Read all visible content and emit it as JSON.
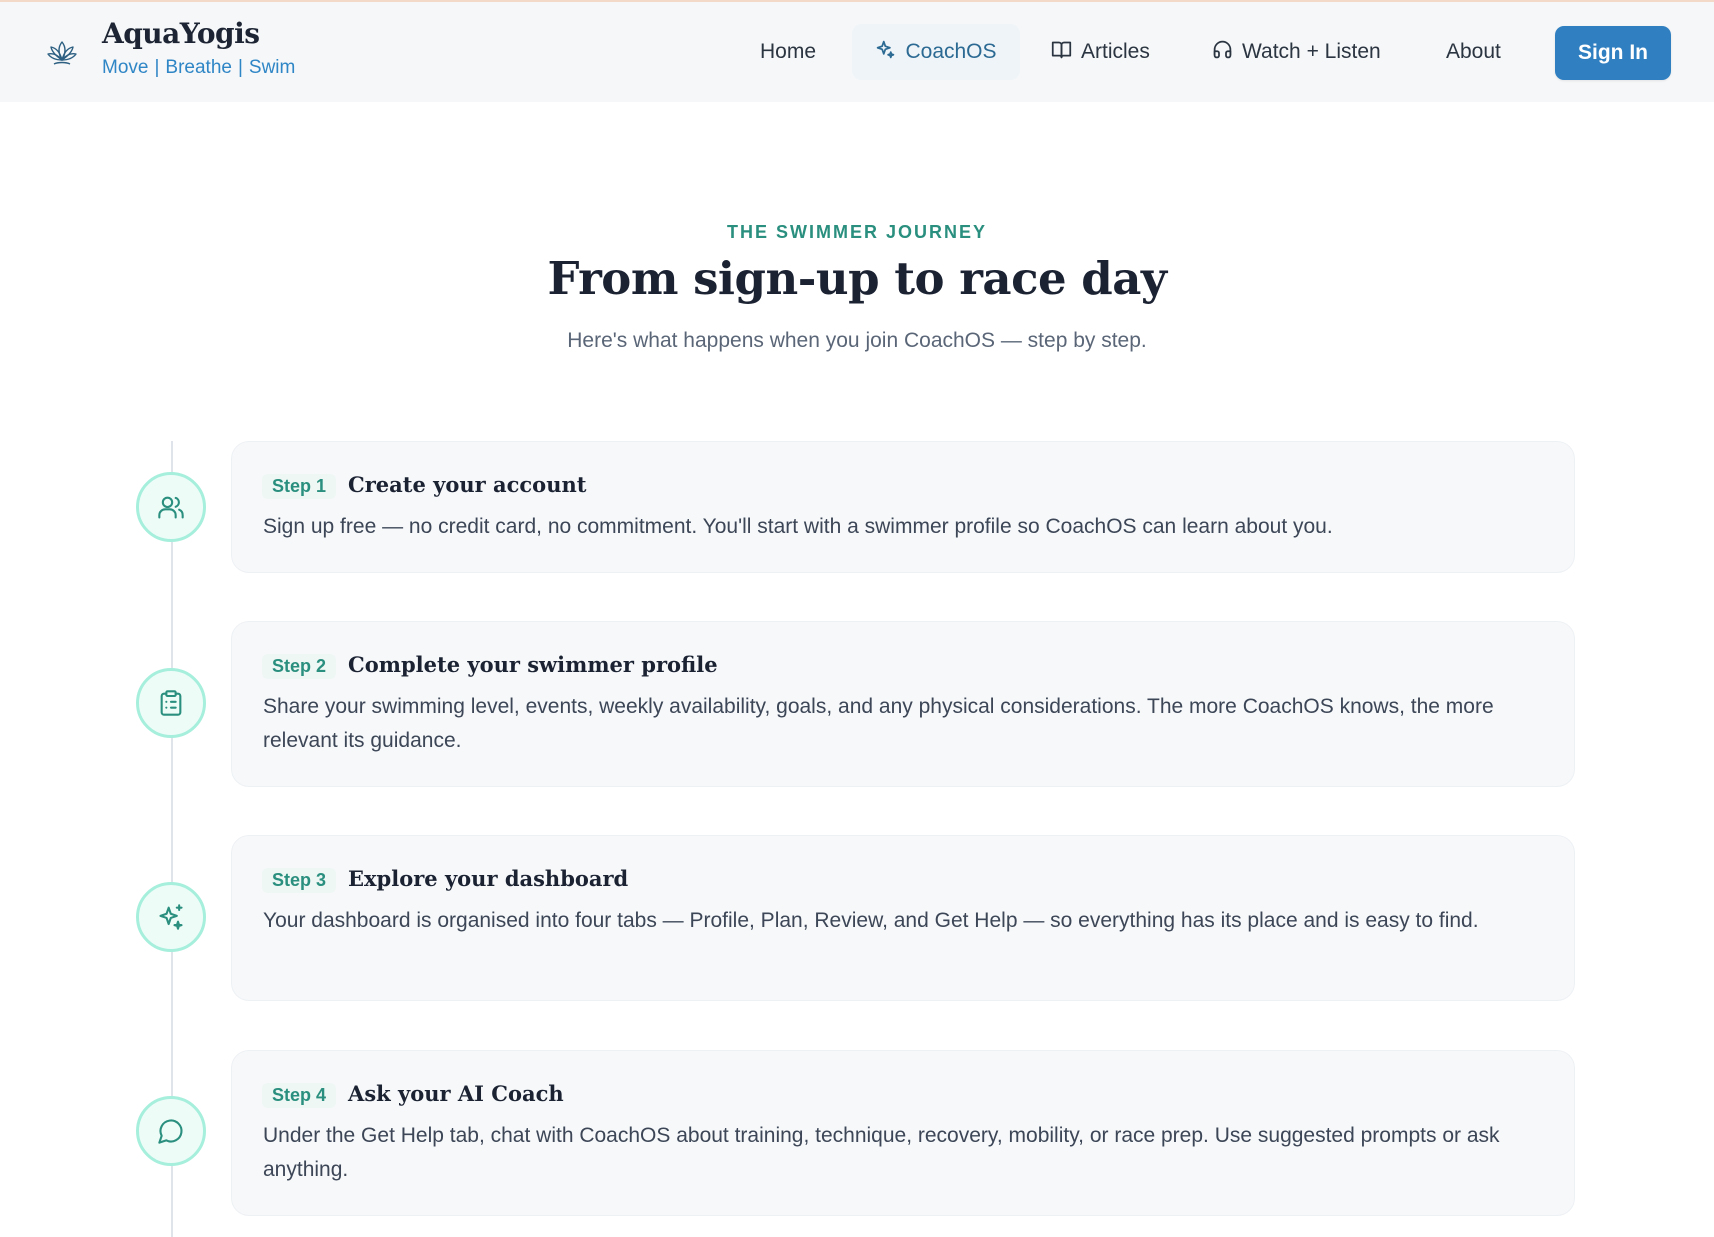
{
  "header": {
    "brand_name": "AquaYogis",
    "tagline": [
      "Move",
      "Breathe",
      "Swim"
    ],
    "nav": {
      "home": "Home",
      "coachos": "CoachOS",
      "articles": "Articles",
      "watch_listen": "Watch + Listen",
      "about": "About"
    },
    "sign_in": "Sign In"
  },
  "hero": {
    "eyebrow": "THE SWIMMER JOURNEY",
    "title": "From sign-up to race day",
    "subtitle": "Here's what happens when you join CoachOS — step by step."
  },
  "steps": [
    {
      "label": "Step 1",
      "title": "Create your account",
      "description": "Sign up free — no credit card, no commitment. You'll start with a swimmer profile so CoachOS can learn about you.",
      "icon": "users-icon"
    },
    {
      "label": "Step 2",
      "title": "Complete your swimmer profile",
      "description": "Share your swimming level, events, weekly availability, goals, and any physical considerations. The more CoachOS knows, the more relevant its guidance.",
      "icon": "clipboard-icon"
    },
    {
      "label": "Step 3",
      "title": "Explore your dashboard",
      "description": "Your dashboard is organised into four tabs — Profile, Plan, Review, and Get Help — so everything has its place and is easy to find.",
      "icon": "sparkles-icon"
    },
    {
      "label": "Step 4",
      "title": "Ask your AI Coach",
      "description": "Under the Get Help tab, chat with CoachOS about training, technique, recovery, mobility, or race prep. Use suggested prompts or ask anything.",
      "icon": "chat-bubble-icon"
    }
  ],
  "colors": {
    "accent_teal": "#2a8f7e",
    "brand_blue": "#2f7fc1",
    "icon_ring": "#a6efdc"
  }
}
